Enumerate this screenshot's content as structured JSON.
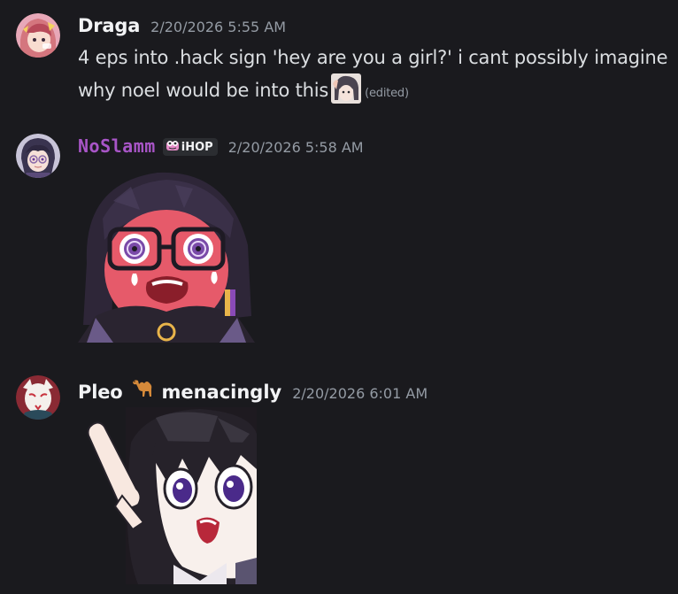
{
  "messages": [
    {
      "author": "Draga",
      "timestamp": "2/20/2026 5:55 AM",
      "line1": "4 eps into .hack sign 'hey are you a girl?' i cant possibly imagine",
      "line2": "why noel would be into this",
      "edited": "(edited)",
      "avatar_icon": "anime-girl-avatar-icon",
      "emoji_icon": "anime-face-emoji-icon"
    },
    {
      "author": "NoSlamm",
      "author_color": "#a855c7",
      "tag_label": "iHOP",
      "tag_icon": "frog-face-icon",
      "timestamp": "2/20/2026 5:58 AM",
      "avatar_icon": "glasses-girl-avatar-icon",
      "sticker_icon": "flustered-anime-girl-sticker"
    },
    {
      "author": "Pleo",
      "author_extra": "menacingly",
      "author_icon": "camel-icon",
      "timestamp": "2/20/2026 6:01 AM",
      "avatar_icon": "kitsune-mask-avatar-icon",
      "sticker_icon": "shocked-pointing-girl-sticker"
    }
  ]
}
